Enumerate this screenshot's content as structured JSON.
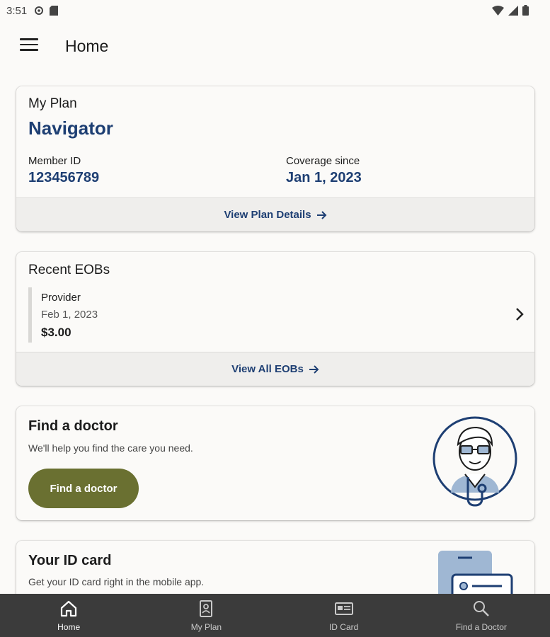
{
  "status": {
    "time": "3:51"
  },
  "appbar": {
    "title": "Home"
  },
  "plan": {
    "label": "My Plan",
    "name": "Navigator",
    "member_id_label": "Member ID",
    "member_id": "123456789",
    "coverage_label": "Coverage since",
    "coverage_date": "Jan 1, 2023",
    "link": "View Plan Details"
  },
  "eobs": {
    "title": "Recent EOBs",
    "items": [
      {
        "provider": "Provider",
        "date": "Feb 1, 2023",
        "amount": "$3.00"
      }
    ],
    "link": "View All EOBs"
  },
  "doctor": {
    "title": "Find a doctor",
    "description": "We'll help you find the care you need.",
    "button": "Find a doctor"
  },
  "idcard": {
    "title": "Your ID card",
    "description": "Get your ID card right in the mobile app."
  },
  "nav": {
    "items": [
      {
        "label": "Home",
        "icon": "home-icon",
        "active": true
      },
      {
        "label": "My Plan",
        "icon": "plan-icon",
        "active": false
      },
      {
        "label": "ID Card",
        "icon": "id-card-icon",
        "active": false
      },
      {
        "label": "Find a Doctor",
        "icon": "search-icon",
        "active": false
      }
    ]
  },
  "colors": {
    "brand_blue": "#1e3f73",
    "button_olive": "#6a7031",
    "nav_bg": "#3b3b3b",
    "page_bg": "#fbfaf8"
  }
}
